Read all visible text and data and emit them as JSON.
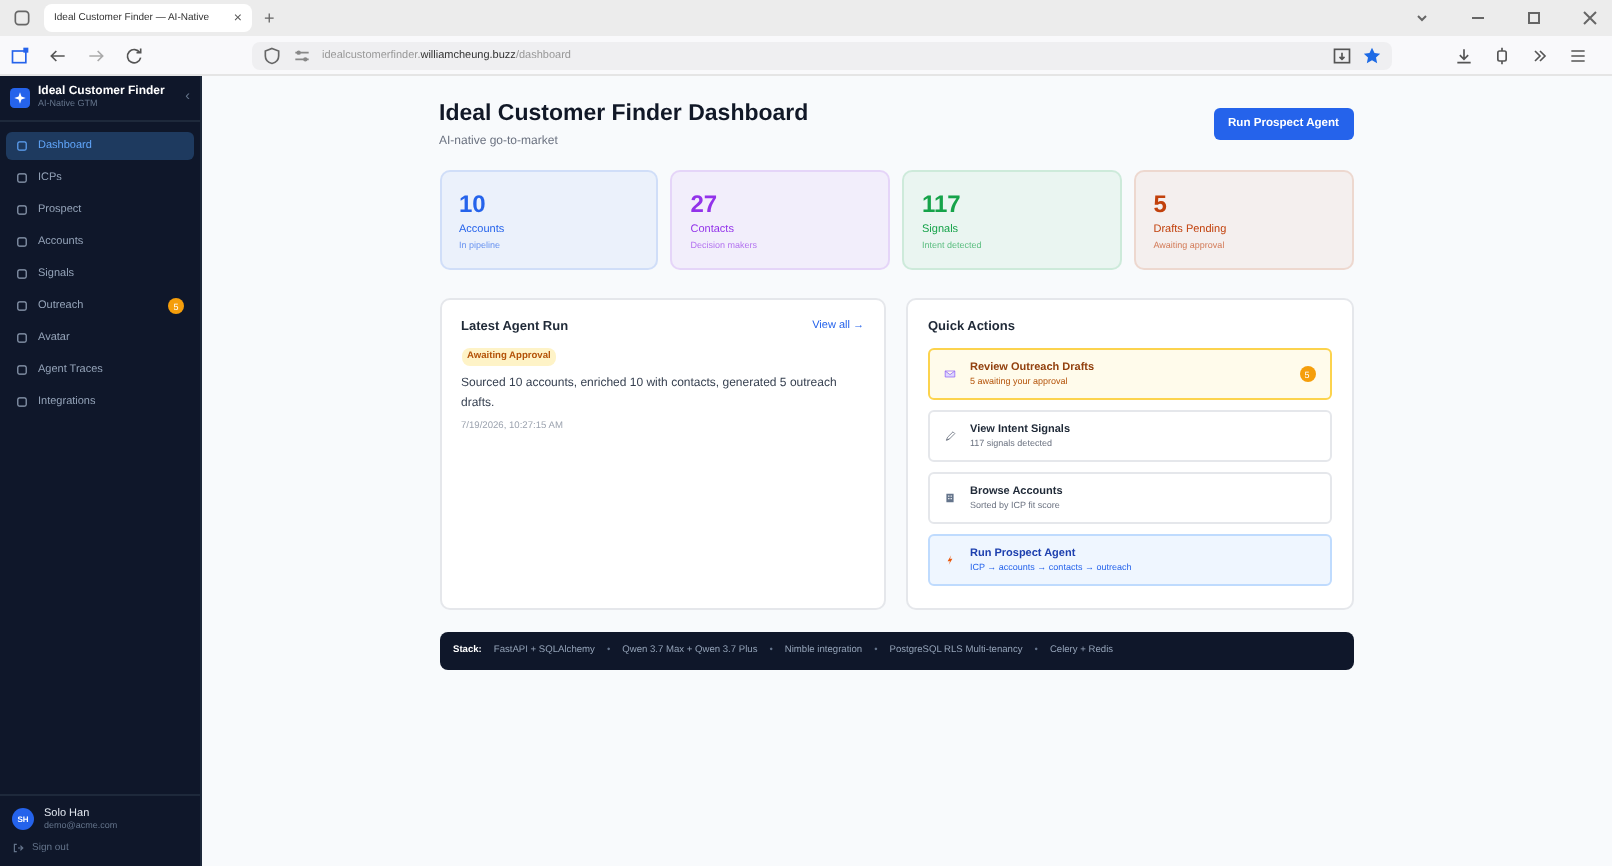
{
  "browser": {
    "tab_title": "Ideal Customer Finder — AI-Native",
    "tab_close": "×",
    "new_tab": "+",
    "url": "idealcustomerfinder.**williamcheung.buzz**/dashboard"
  },
  "sidebar": {
    "app_name": "Ideal Customer Finder",
    "app_subtitle": "AI-Native GTM",
    "collapse": "‹",
    "items": [
      {
        "label": "Dashboard",
        "selected": true
      },
      {
        "label": "ICPs",
        "selected": false
      },
      {
        "label": "Prospect",
        "selected": false
      },
      {
        "label": "Accounts",
        "selected": false
      },
      {
        "label": "Signals",
        "selected": false
      },
      {
        "label": "Outreach",
        "selected": false,
        "badge": "5"
      },
      {
        "label": "Avatar",
        "selected": false
      },
      {
        "label": "Agent Traces",
        "selected": false
      },
      {
        "label": "Integrations",
        "selected": false
      }
    ],
    "user": {
      "initials": "SH",
      "name": "Solo Han",
      "email": "demo@acme.com"
    },
    "sign_out": "Sign out"
  },
  "header": {
    "title": "Ideal Customer Finder Dashboard",
    "subtitle": "AI-native go-to-market",
    "action": "Run Prospect Agent"
  },
  "stats": [
    {
      "value": "10",
      "label": "Accounts",
      "note": "In pipeline",
      "color": "#2563eb"
    },
    {
      "value": "27",
      "label": "Contacts",
      "note": "Decision makers",
      "color": "#9333ea"
    },
    {
      "value": "117",
      "label": "Signals",
      "note": "Intent detected",
      "color": "#16a34a"
    },
    {
      "value": "5",
      "label": "Drafts Pending",
      "note": "Awaiting approval",
      "color": "#c2410c"
    }
  ],
  "latest_run": {
    "title": "Latest Agent Run",
    "view_all": "View all →",
    "status": "Awaiting Approval",
    "summary": "Sourced 10 accounts, enriched 10 with contacts, generated 5 outreach drafts.",
    "timestamp": "7/19/2026, 10:27:15 AM"
  },
  "quick_actions": {
    "title": "Quick Actions",
    "items": [
      {
        "kind": "warning",
        "title": "Review Outreach Drafts",
        "subtitle": "5 awaiting your approval",
        "badge": "5"
      },
      {
        "kind": "plain",
        "title": "View Intent Signals",
        "subtitle": "117 signals detected"
      },
      {
        "kind": "plain",
        "title": "Browse Accounts",
        "subtitle": "Sorted by ICP fit score"
      },
      {
        "kind": "primary",
        "title": "Run Prospect Agent",
        "subtitle": "ICP → accounts → contacts → outreach"
      }
    ]
  },
  "stack": {
    "label": "Stack:",
    "separator": "•",
    "items": [
      "FastAPI + SQLAlchemy",
      "Qwen 3.7 Max + Qwen 3.7 Plus",
      "Nimble integration",
      "PostgreSQL RLS Multi-tenancy",
      "Celery + Redis"
    ]
  }
}
